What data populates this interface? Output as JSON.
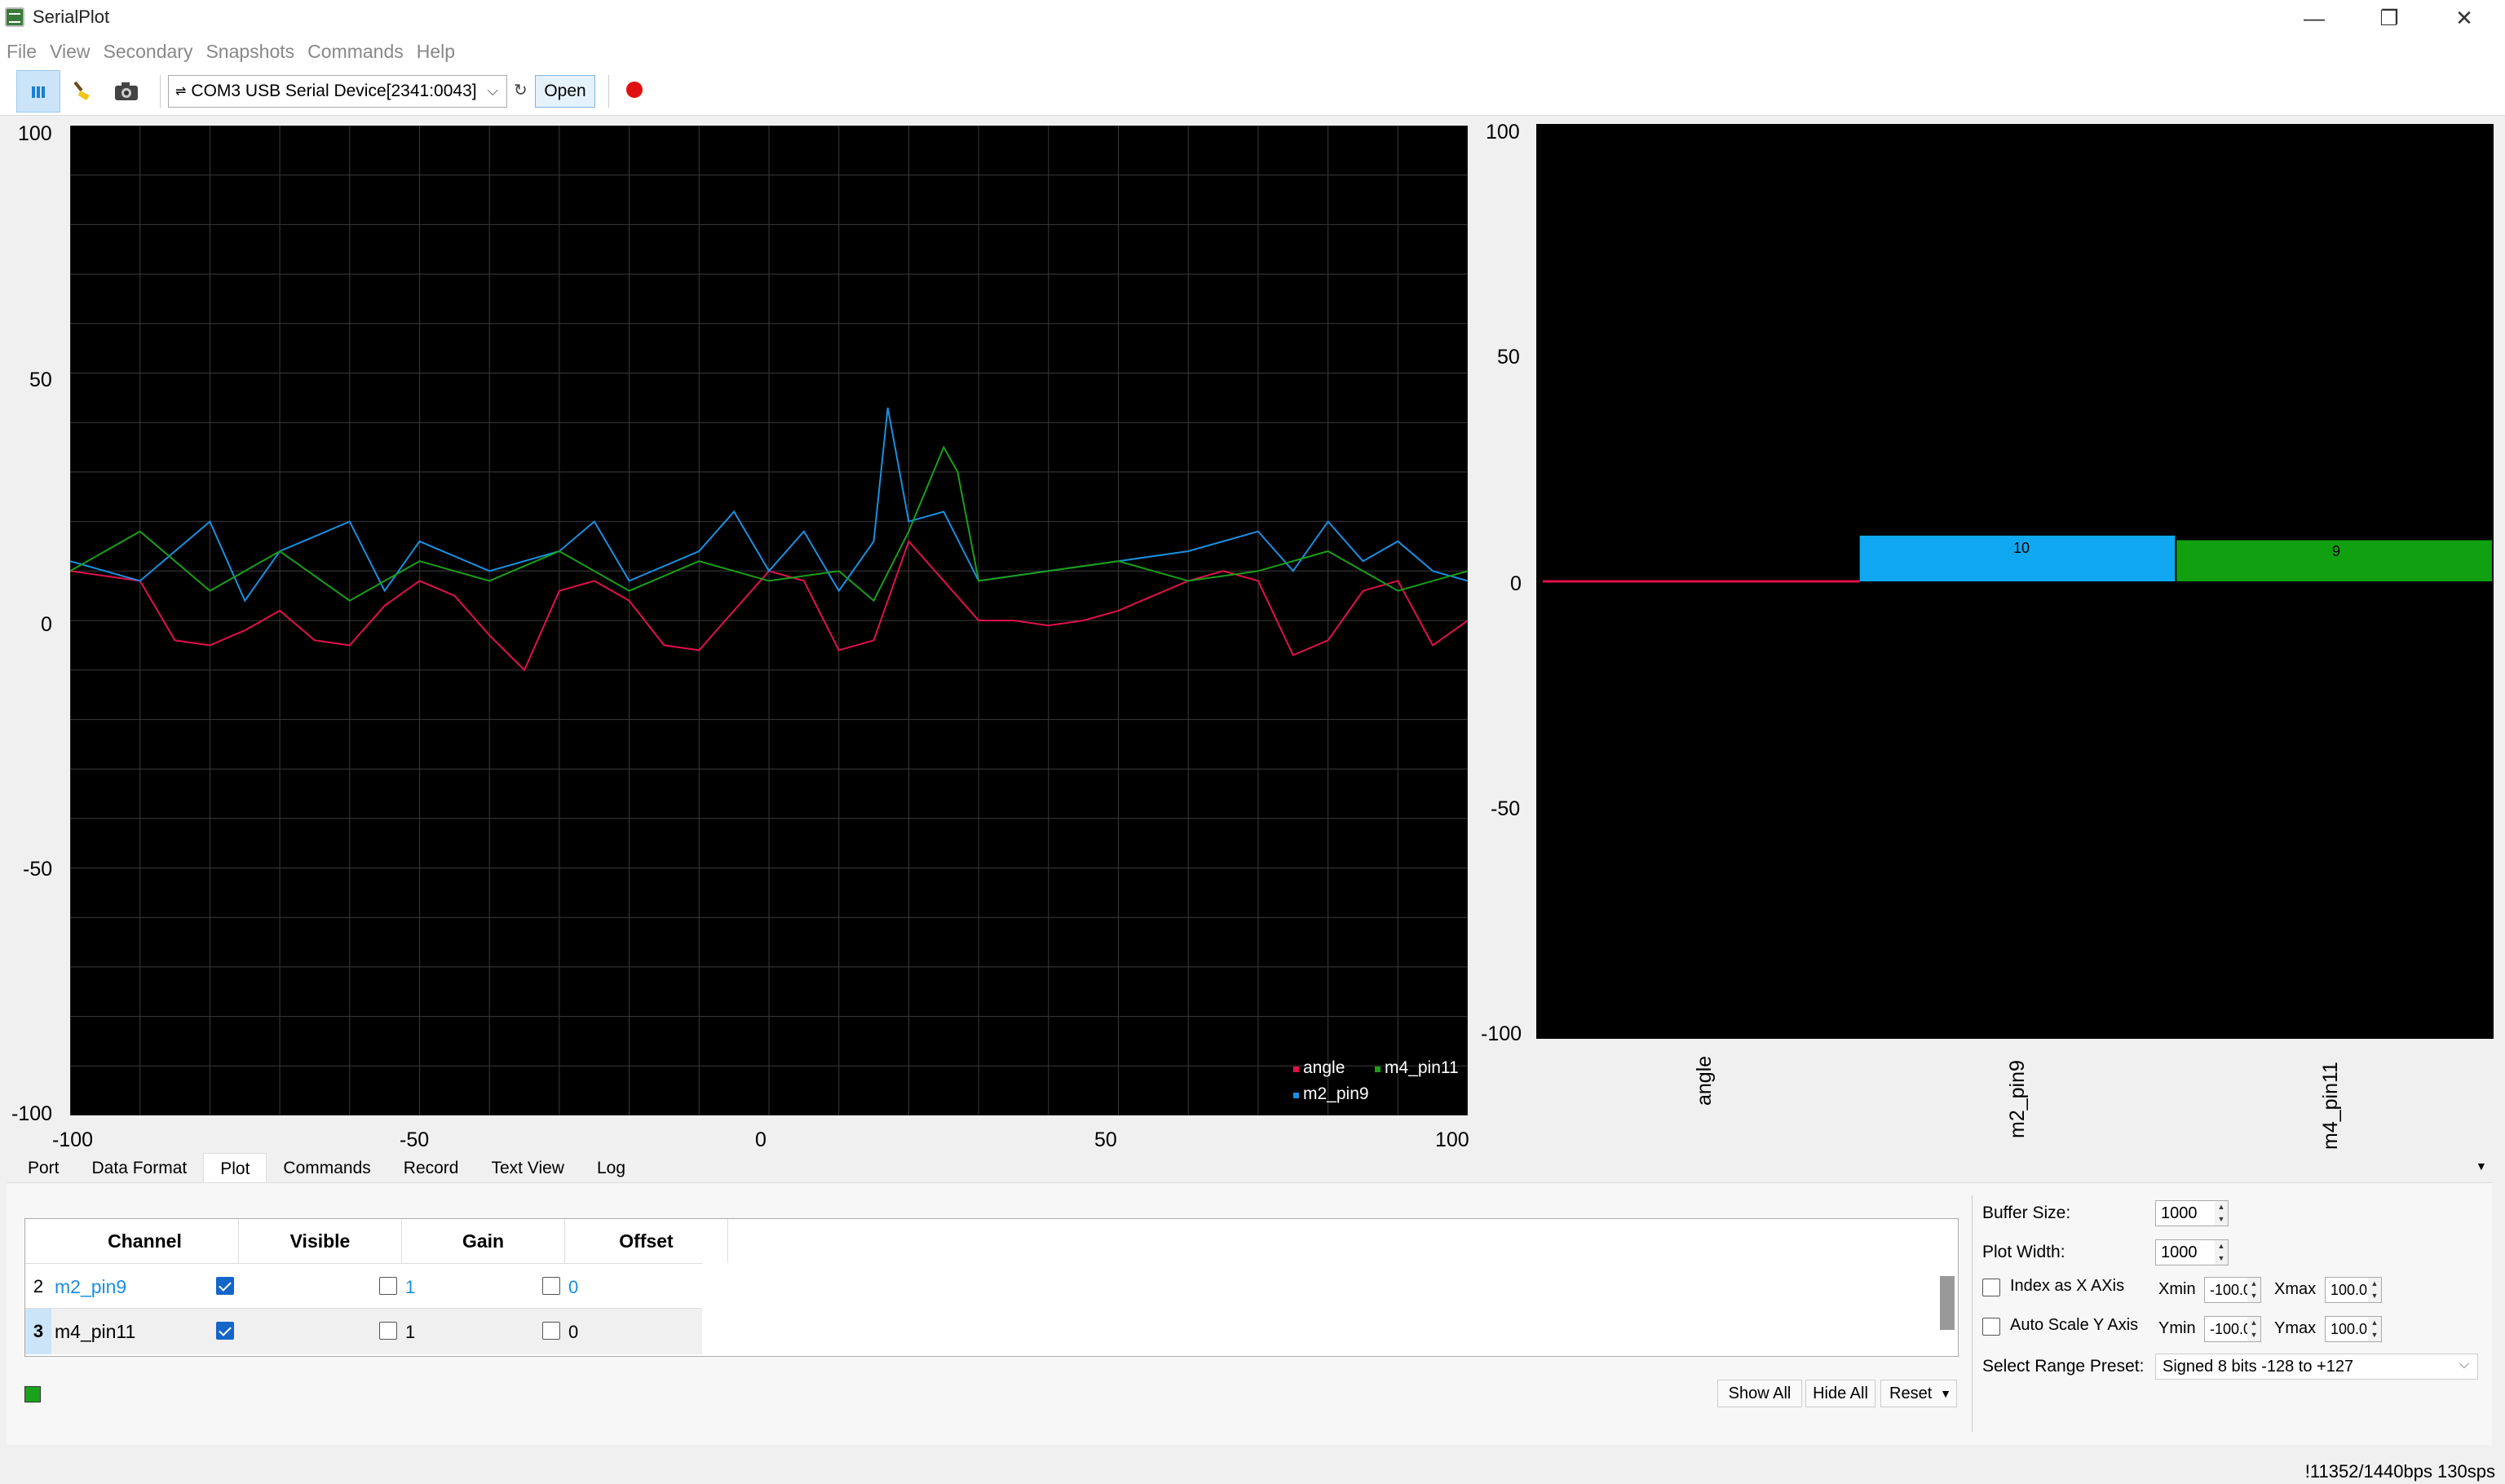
{
  "window": {
    "title": "SerialPlot",
    "minimize_glyph": "—",
    "restore_glyph": "❐",
    "close_glyph": "✕"
  },
  "menu": [
    "File",
    "View",
    "Secondary",
    "Snapshots",
    "Commands",
    "Help"
  ],
  "toolbar": {
    "port": "COM3 USB Serial Device[2341:0043]",
    "open_label": "Open",
    "icons": [
      "bar-chart-icon",
      "brush-icon",
      "camera-icon",
      "usb-icon",
      "refresh-icon",
      "record-icon"
    ]
  },
  "line_plot": {
    "y_ticks": [
      "100",
      "50",
      "0",
      "-50",
      "-100"
    ],
    "x_ticks": [
      "-100",
      "-50",
      "0",
      "50",
      "100"
    ]
  },
  "bar_plot": {
    "y_ticks": [
      "100",
      "50",
      "0",
      "-50",
      "-100"
    ]
  },
  "chart_data": [
    {
      "type": "line",
      "xlim": [
        -100,
        100
      ],
      "ylim": [
        -100,
        100
      ],
      "grid": true,
      "legend": "bottom-right",
      "series": [
        {
          "name": "angle",
          "color": "#e0104a",
          "x": [
            -100,
            -90,
            -85,
            -80,
            -75,
            -70,
            -65,
            -60,
            -55,
            -50,
            -45,
            -40,
            -35,
            -30,
            -25,
            -20,
            -15,
            -10,
            -5,
            0,
            5,
            10,
            15,
            20,
            25,
            30,
            35,
            40,
            45,
            50,
            55,
            60,
            65,
            70,
            75,
            80,
            85,
            90,
            95,
            100
          ],
          "y": [
            10,
            8,
            -4,
            -5,
            -2,
            2,
            -4,
            -5,
            3,
            8,
            5,
            -3,
            -10,
            6,
            8,
            4,
            -5,
            -6,
            2,
            10,
            8,
            -6,
            -4,
            16,
            8,
            0,
            0,
            -1,
            0,
            2,
            5,
            8,
            10,
            8,
            -7,
            -4,
            6,
            8,
            -5,
            0
          ]
        },
        {
          "name": "m2_pin9",
          "color": "#1a8fe0",
          "x": [
            -100,
            -90,
            -80,
            -75,
            -70,
            -60,
            -55,
            -50,
            -40,
            -30,
            -25,
            -20,
            -10,
            -5,
            0,
            5,
            10,
            15,
            17,
            20,
            25,
            30,
            40,
            50,
            60,
            70,
            75,
            80,
            85,
            90,
            95,
            100
          ],
          "y": [
            12,
            8,
            20,
            4,
            14,
            20,
            6,
            16,
            10,
            14,
            20,
            8,
            14,
            22,
            10,
            18,
            6,
            16,
            43,
            20,
            22,
            8,
            10,
            12,
            14,
            18,
            10,
            20,
            12,
            16,
            10,
            8
          ]
        },
        {
          "name": "m4_pin11",
          "color": "#1a9e1a",
          "x": [
            -100,
            -90,
            -80,
            -70,
            -60,
            -50,
            -40,
            -30,
            -20,
            -10,
            0,
            10,
            15,
            20,
            25,
            27,
            30,
            40,
            50,
            60,
            70,
            80,
            90,
            100
          ],
          "y": [
            10,
            18,
            6,
            14,
            4,
            12,
            8,
            14,
            6,
            12,
            8,
            10,
            4,
            18,
            35,
            30,
            8,
            10,
            12,
            8,
            10,
            14,
            6,
            10
          ]
        }
      ]
    },
    {
      "type": "bar",
      "categories": [
        "angle",
        "m2_pin9",
        "m4_pin11"
      ],
      "values": [
        0,
        10,
        9
      ],
      "colors": [
        "#e0104a",
        "#10a8f0",
        "#10a010"
      ],
      "ylim": [
        -100,
        100
      ]
    }
  ],
  "legend": [
    "angle",
    "m4_pin11",
    "m2_pin9"
  ],
  "bar_value_labels": [
    "10",
    "9"
  ],
  "tabs": [
    "Port",
    "Data Format",
    "Plot",
    "Commands",
    "Record",
    "Text View",
    "Log"
  ],
  "active_tab": "Plot",
  "channel_table": {
    "headers": [
      "Channel",
      "Visible",
      "Gain",
      "Offset"
    ],
    "rows": [
      {
        "num": "2",
        "channel": "m2_pin9",
        "visible": true,
        "gain": "1",
        "offset": "0"
      },
      {
        "num": "3",
        "channel": "m4_pin11",
        "visible": true,
        "gain": "1",
        "offset": "0"
      }
    ]
  },
  "buttons": {
    "show_all": "Show All",
    "hide_all": "Hide All",
    "reset": "Reset"
  },
  "settings": {
    "buffer_size_label": "Buffer Size:",
    "buffer_size": "1000",
    "plot_width_label": "Plot Width:",
    "plot_width": "1000",
    "index_x_label": "Index as X AXis",
    "auto_scale_label": "Auto Scale Y Axis",
    "xmin_label": "Xmin",
    "xmin": "-100.0",
    "xmax_label": "Xmax",
    "xmax": "100.0",
    "ymin_label": "Ymin",
    "ymin": "-100.0",
    "ymax_label": "Ymax",
    "ymax": "100.0",
    "range_preset_label": "Select Range Preset:",
    "range_preset": "Signed 8 bits -128 to +127"
  },
  "status": "!11352/1440bps 130sps"
}
